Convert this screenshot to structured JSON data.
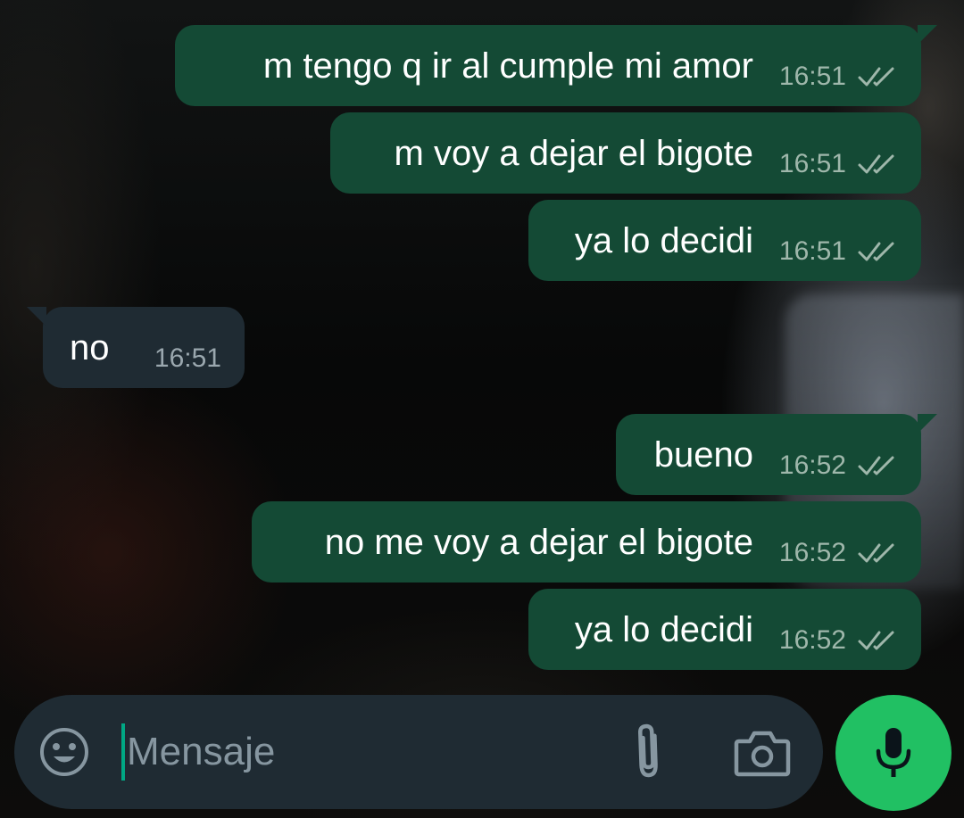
{
  "messages": [
    {
      "direction": "out",
      "text": "m tengo q ir al cumple mi amor",
      "time": "16:51",
      "status_icon": "double-check-icon"
    },
    {
      "direction": "out",
      "text": "m voy a dejar el bigote",
      "time": "16:51",
      "status_icon": "double-check-icon"
    },
    {
      "direction": "out",
      "text": "ya lo decidi",
      "time": "16:51",
      "status_icon": "double-check-icon"
    },
    {
      "direction": "in",
      "text": "no",
      "time": "16:51"
    },
    {
      "direction": "out",
      "text": "bueno",
      "time": "16:52",
      "status_icon": "double-check-icon"
    },
    {
      "direction": "out",
      "text": "no me voy a dejar el bigote",
      "time": "16:52",
      "status_icon": "double-check-icon"
    },
    {
      "direction": "out",
      "text": "ya lo decidi",
      "time": "16:52",
      "status_icon": "double-check-icon"
    }
  ],
  "composer": {
    "placeholder": "Mensaje",
    "value": "",
    "emoji_icon": "emoji-icon",
    "attach_icon": "paperclip-icon",
    "camera_icon": "camera-icon",
    "mic_icon": "microphone-icon"
  },
  "colors": {
    "outgoing_bubble": "#144a35",
    "incoming_bubble": "#1f2b33",
    "accent": "#21c063",
    "read_ticks": "#9fb7ab"
  }
}
